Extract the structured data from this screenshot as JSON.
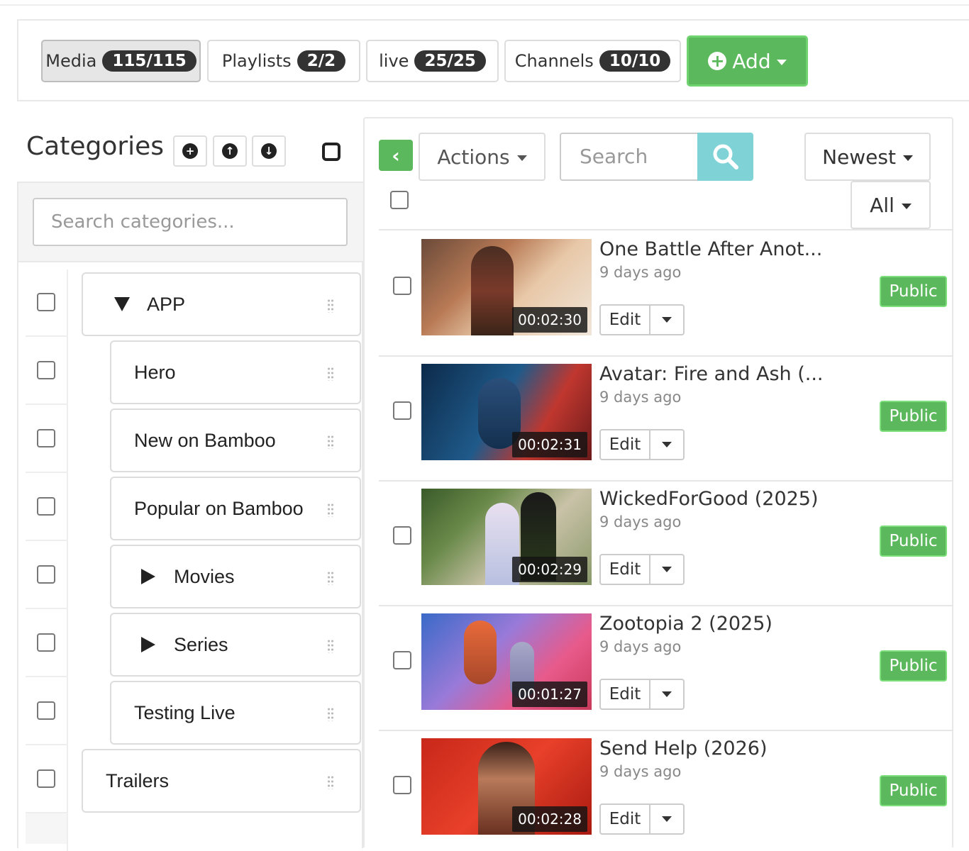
{
  "tabs": [
    {
      "label": "Media",
      "count": "115/115"
    },
    {
      "label": "Playlists",
      "count": "2/2"
    },
    {
      "label": "live",
      "count": "25/25"
    },
    {
      "label": "Channels",
      "count": "10/10"
    }
  ],
  "add_button": {
    "label": "Add"
  },
  "categories": {
    "title": "Categories",
    "search_placeholder": "Search categories...",
    "items": [
      {
        "label": "APP",
        "toggle": "expanded"
      },
      {
        "label": "Hero"
      },
      {
        "label": "New on Bamboo"
      },
      {
        "label": "Popular on Bamboo"
      },
      {
        "label": "Movies",
        "toggle": "collapsed"
      },
      {
        "label": "Series",
        "toggle": "collapsed"
      },
      {
        "label": "Testing Live"
      },
      {
        "label": "Trailers"
      }
    ]
  },
  "toolbar": {
    "actions_label": "Actions",
    "search_placeholder": "Search",
    "sort_label": "Newest",
    "filter_label": "All"
  },
  "media": [
    {
      "title": "One Battle After Anot...",
      "date": "9 days ago",
      "duration": "00:02:30",
      "status": "Public",
      "edit": "Edit"
    },
    {
      "title": "Avatar: Fire and Ash (...",
      "date": "9 days ago",
      "duration": "00:02:31",
      "status": "Public",
      "edit": "Edit"
    },
    {
      "title": "WickedForGood (2025)",
      "date": "9 days ago",
      "duration": "00:02:29",
      "status": "Public",
      "edit": "Edit"
    },
    {
      "title": "Zootopia 2 (2025)",
      "date": "9 days ago",
      "duration": "00:01:27",
      "status": "Public",
      "edit": "Edit"
    },
    {
      "title": "Send Help (2026)",
      "date": "9 days ago",
      "duration": "00:02:28",
      "status": "Public",
      "edit": "Edit"
    }
  ],
  "colors": {
    "accent_green": "#5cb85c",
    "search_button": "#7fd3d6"
  }
}
